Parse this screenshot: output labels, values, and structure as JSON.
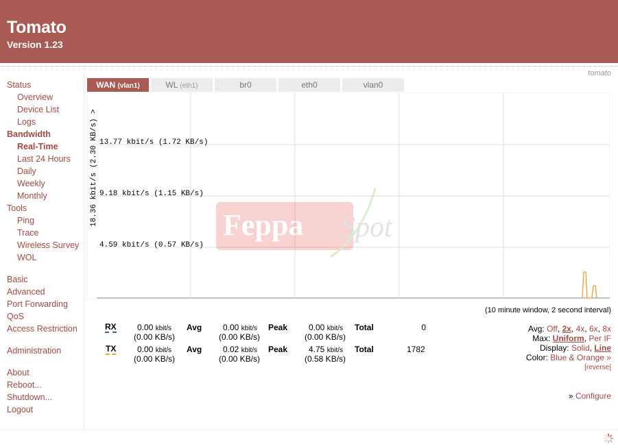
{
  "header": {
    "title": "Tomato",
    "version": "Version 1.23"
  },
  "hostname": "tomato",
  "sidebar": {
    "status": "Status",
    "overview": "Overview",
    "device_list": "Device List",
    "logs": "Logs",
    "bandwidth": "Bandwidth",
    "realtime": "Real-Time",
    "last24": "Last 24 Hours",
    "daily": "Daily",
    "weekly": "Weekly",
    "monthly": "Monthly",
    "tools": "Tools",
    "ping": "Ping",
    "trace": "Trace",
    "wireless_survey": "Wireless Survey",
    "wol": "WOL",
    "basic": "Basic",
    "advanced": "Advanced",
    "port_forwarding": "Port Forwarding",
    "qos": "QoS",
    "access_restriction": "Access Restriction",
    "administration": "Administration",
    "about": "About",
    "reboot": "Reboot...",
    "shutdown": "Shutdown...",
    "logout": "Logout"
  },
  "tabs": [
    {
      "label": "WAN",
      "sub": "(vlan1)"
    },
    {
      "label": "WL",
      "sub": "(eth1)"
    },
    {
      "label": "br0",
      "sub": ""
    },
    {
      "label": "eth0",
      "sub": ""
    },
    {
      "label": "vlan0",
      "sub": ""
    }
  ],
  "graph": {
    "y_max_label": "18.36 kbit/s (2.30 KB/s) >",
    "line1": "13.77 kbit/s (1.72 KB/s)",
    "line2": "9.18 kbit/s (1.15 KB/s)",
    "line3": "4.59 kbit/s (0.57 KB/s)",
    "watermark_main": "Feppa",
    "watermark_script": "Spot",
    "colors": {
      "rx": "#3b5ea8",
      "tx": "#f0a030",
      "grid": "#dcdcdc"
    }
  },
  "window_label": "(10 minute window, 2 second interval)",
  "stats": {
    "rx": {
      "label": "RX",
      "cur": "0.00",
      "cur_kb": "(0.00 KB/s)",
      "avg": "0.00",
      "avg_kb": "(0.00 KB/s)",
      "peak": "0.00",
      "peak_kb": "(0.00 KB/s)",
      "total": "0"
    },
    "tx": {
      "label": "TX",
      "cur": "0.00",
      "cur_kb": "(0.00 KB/s)",
      "avg": "0.02",
      "avg_kb": "(0.00 KB/s)",
      "peak": "4.75",
      "peak_kb": "(0.58 KB/s)",
      "total": "1782"
    },
    "unit": "kbit/s",
    "avg_label": "Avg",
    "peak_label": "Peak",
    "total_label": "Total"
  },
  "options": {
    "avg_label": "Avg:",
    "avg_off": "Off",
    "avg_2x": "2x",
    "avg_4x": "4x",
    "avg_6x": "6x",
    "avg_8x": "8x",
    "max_label": "Max:",
    "max_uniform": "Uniform",
    "max_perif": "Per IF",
    "display_label": "Display:",
    "display_solid": "Solid",
    "display_line": "Line",
    "color_label": "Color:",
    "color_value": "Blue & Orange »",
    "reverse": "[reverse]",
    "configure": "Configure",
    "configure_prefix": "»"
  }
}
